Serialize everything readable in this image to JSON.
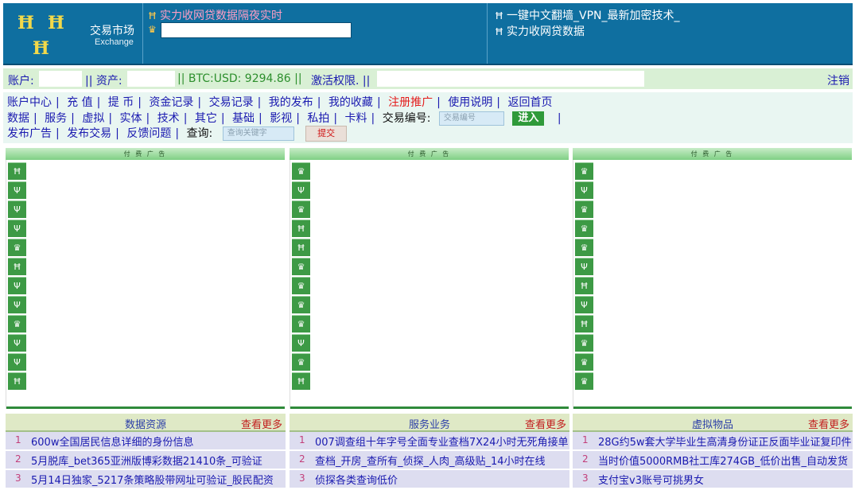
{
  "header": {
    "logo_glyph": "Ħ",
    "market_cn": "交易市场",
    "market_en": "Exchange",
    "mid_link": "实力收网贷数据隔夜实时",
    "right_links": [
      "一键中文翻墙_VPN_最新加密技术_",
      "实力收网贷数据"
    ]
  },
  "account_bar": {
    "account_label": "账户:",
    "assets_label": "|| 资产:",
    "btc_rate": "|| BTC:USD: 9294.86 ||",
    "activate": "激活权限. ||",
    "logout": "注销"
  },
  "nav": {
    "row1": [
      "账户中心",
      "充 值",
      "提 币",
      "资金记录",
      "交易记录",
      "我的发布",
      "我的收藏",
      "注册推广",
      "使用说明",
      "返回首页"
    ],
    "row2": [
      "数据",
      "服务",
      "虚拟",
      "实体",
      "技术",
      "其它",
      "基础",
      "影视",
      "私拍",
      "卡料"
    ],
    "trade_no_label": "交易编号:",
    "trade_no_placeholder": "交易编号",
    "go_button": "进入",
    "row3": [
      "发布广告",
      "发布交易",
      "反馈问题"
    ],
    "search_label": "查询:",
    "search_placeholder": "查询关键字",
    "submit_button": "提交"
  },
  "ads": {
    "header": "付 费 广 告",
    "column_icons": [
      [
        "Ħ",
        "Ψ",
        "Ψ",
        "Ψ",
        "♛",
        "Ħ",
        "Ψ",
        "Ψ",
        "♛",
        "Ψ",
        "Ψ",
        "Ħ"
      ],
      [
        "♛",
        "Ψ",
        "♛",
        "Ħ",
        "Ħ",
        "♛",
        "♛",
        "♛",
        "♛",
        "Ψ",
        "♛",
        "Ħ"
      ],
      [
        "♛",
        "Ψ",
        "♛",
        "♛",
        "♛",
        "Ψ",
        "Ħ",
        "Ψ",
        "Ħ",
        "♛",
        "♛",
        "♛"
      ]
    ]
  },
  "lists": [
    {
      "title": "数据资源",
      "more": "查看更多",
      "items": [
        {
          "num": "1",
          "text": "600w全国居民信息详细的身份信息"
        },
        {
          "num": "2",
          "text": "5月脱库_bet365亚洲版博彩数据21410条_可验证"
        },
        {
          "num": "3",
          "text": "5月14日独家_5217条策略股带网址可验证_股民配资"
        }
      ]
    },
    {
      "title": "服务业务",
      "more": "查看更多",
      "items": [
        {
          "num": "1",
          "text": "007调查组十年字号全面专业查档7X24小时无死角接单"
        },
        {
          "num": "2",
          "text": "查档_开房_查所有_侦探_人肉_高级贴_14小时在线"
        },
        {
          "num": "3",
          "text": "侦探各类查询低价"
        }
      ]
    },
    {
      "title": "虚拟物品",
      "more": "查看更多",
      "items": [
        {
          "num": "1",
          "text": "28G约5w套大学毕业生高清身份证正反面毕业证复印件"
        },
        {
          "num": "2",
          "text": "当时价值5000RMB社工库274GB_低价出售_自动发货"
        },
        {
          "num": "3",
          "text": "支付宝v3账号可挑男女"
        }
      ]
    }
  ],
  "colors": {
    "header_bg": "#0f6fa0",
    "link_blue": "#1a1ab0",
    "accent_red": "#e41b1b",
    "ad_green": "#3d9a45"
  }
}
